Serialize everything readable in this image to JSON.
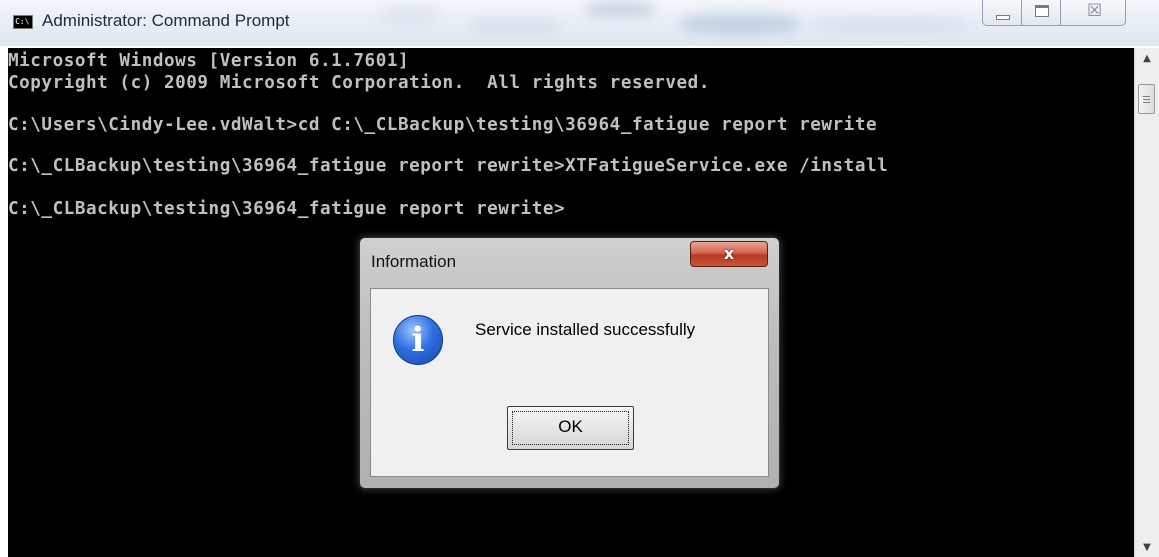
{
  "window": {
    "title": "Administrator: Command Prompt",
    "app_icon_text": "C:\\",
    "controls": {
      "minimize_icon": "minimize-icon",
      "maximize_icon": "maximize-icon",
      "close_glyph": "☒"
    }
  },
  "console": {
    "lines": [
      "Microsoft Windows [Version 6.1.7601]",
      "Copyright (c) 2009 Microsoft Corporation.  All rights reserved.",
      "C:\\Users\\Cindy-Lee.vdWalt>cd C:\\_CLBackup\\testing\\36964_fatigue report rewrite",
      "C:\\_CLBackup\\testing\\36964_fatigue report rewrite>XTFatigueService.exe /install",
      "C:\\_CLBackup\\testing\\36964_fatigue report rewrite>"
    ]
  },
  "scrollbar": {
    "up_arrow": "▲",
    "down_arrow": "▼"
  },
  "dialog": {
    "title": "Information",
    "close_label": "x",
    "icon_glyph": "i",
    "message": "Service installed successfully",
    "ok_label": "OK"
  },
  "colors": {
    "console_bg": "#000000",
    "console_text": "#c0c0c0",
    "dialog_close": "#c7422a",
    "info_icon": "#2f6fe0"
  }
}
